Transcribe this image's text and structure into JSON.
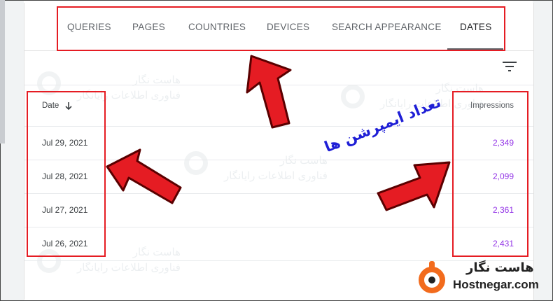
{
  "tabs": [
    {
      "label": "QUERIES"
    },
    {
      "label": "PAGES"
    },
    {
      "label": "COUNTRIES"
    },
    {
      "label": "DEVICES"
    },
    {
      "label": "SEARCH APPEARANCE"
    },
    {
      "label": "DATES",
      "active": true
    }
  ],
  "table": {
    "date_header": "Date",
    "impressions_header": "Impressions",
    "rows": [
      {
        "date": "Jul 29, 2021",
        "impressions": "2,349"
      },
      {
        "date": "Jul 28, 2021",
        "impressions": "2,099"
      },
      {
        "date": "Jul 27, 2021",
        "impressions": "2,361"
      },
      {
        "date": "Jul 26, 2021",
        "impressions": "2,431"
      }
    ]
  },
  "annotation": {
    "persian_label": "تعداد ایمپرشن ها"
  },
  "watermark": {
    "line1": "هاست نگار",
    "line2": "فناوری اطلاعات رایانگار"
  },
  "brand": {
    "name": "هاست نگار",
    "url": "Hostnegar.com"
  },
  "icons": {
    "sort": "arrow-down-icon",
    "filter": "filter-icon"
  },
  "colors": {
    "highlight": "#e51c23",
    "impressions_value": "#9334e6",
    "annotation_text": "#1f1fd6",
    "brand_orange": "#f26b1d"
  }
}
